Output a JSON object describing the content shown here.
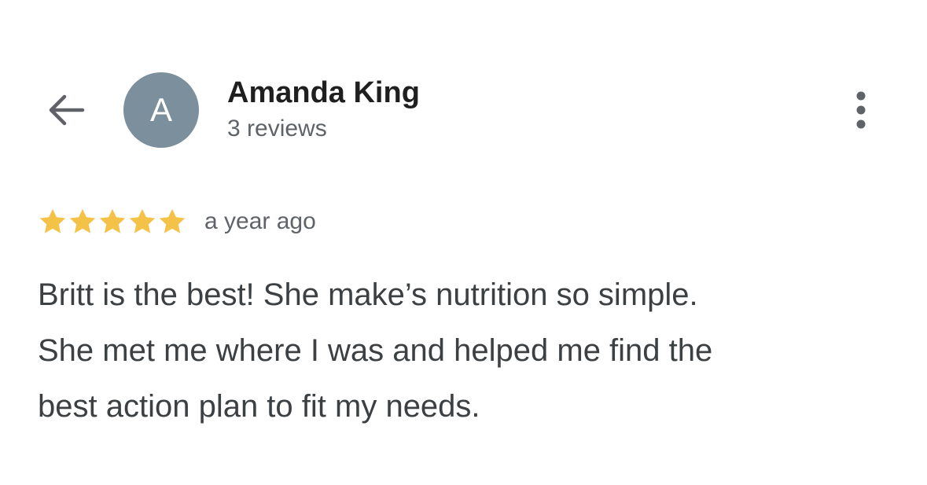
{
  "header": {
    "back_icon": "arrow-back-icon",
    "avatar_letter": "A",
    "avatar_color": "#7b8f9c",
    "reviewer_name": "Amanda King",
    "review_count": "3 reviews",
    "more_icon": "more-vertical-icon"
  },
  "review": {
    "rating": 5,
    "rating_max": 5,
    "star_color": "#f4c247",
    "time": "a year ago",
    "text_lines": [
      "Britt is the best! She make’s nutrition so simple.",
      "She met me where I was and helped me find the",
      "best action plan to fit my needs."
    ]
  }
}
